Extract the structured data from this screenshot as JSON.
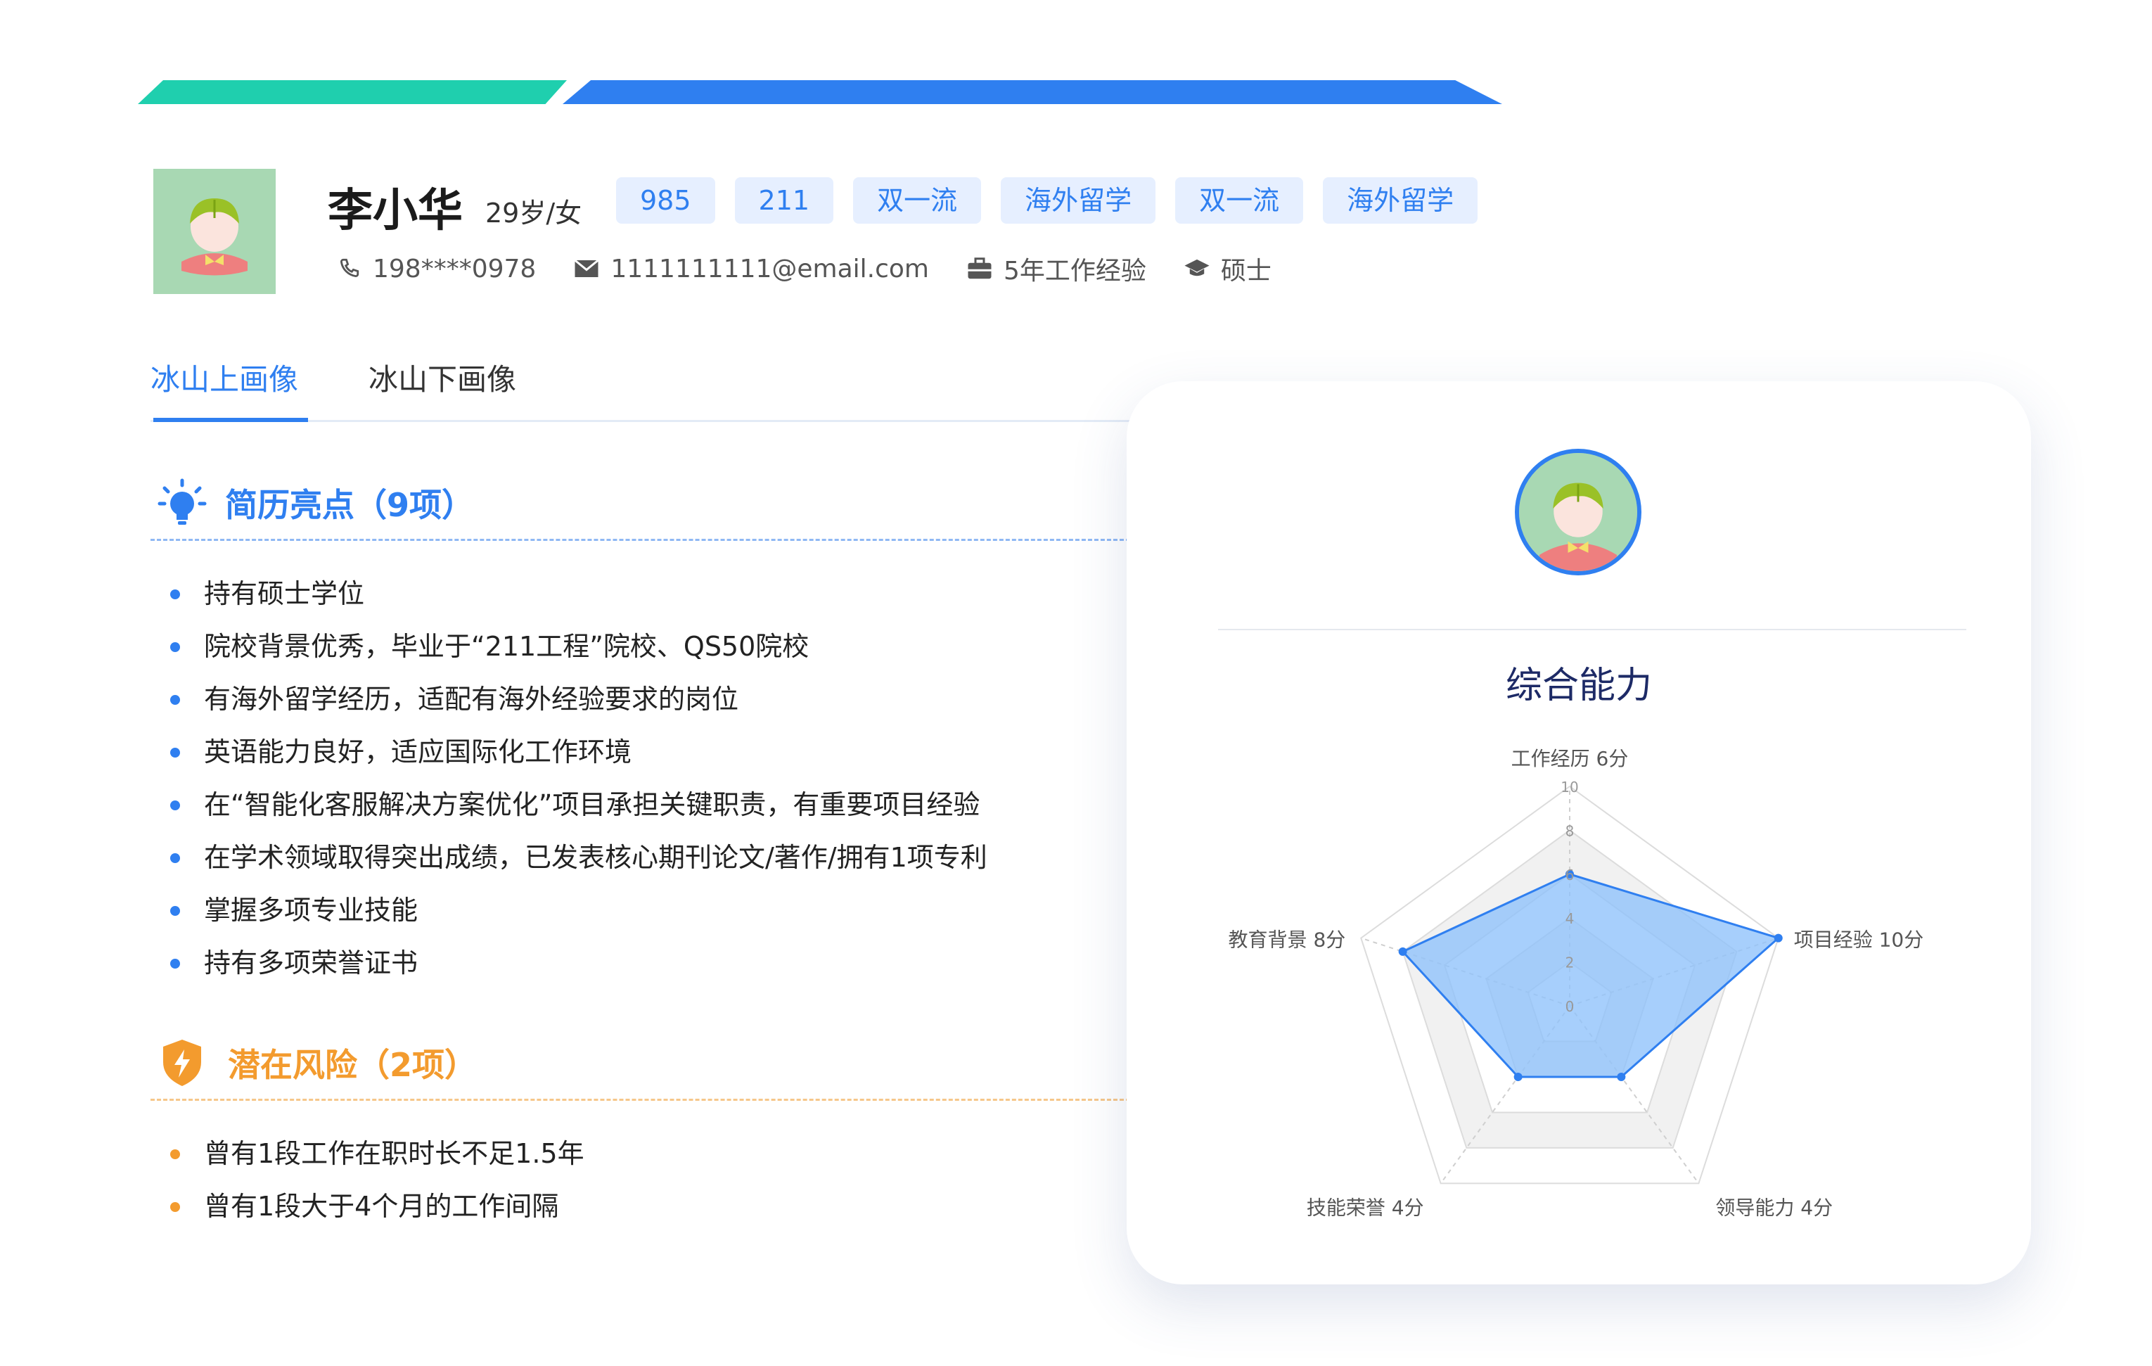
{
  "profile": {
    "name": "李小华",
    "age_gender": "29岁/女",
    "tags": [
      "985",
      "211",
      "双一流",
      "海外留学",
      "双一流",
      "海外留学"
    ],
    "phone": "198****0978",
    "email": "1111111111@email.com",
    "experience": "5年工作经验",
    "degree": "硕士"
  },
  "tabs": {
    "active": "冰山上画像",
    "inactive": "冰山下画像"
  },
  "highlights": {
    "title": "简历亮点（9项）",
    "items": [
      "持有硕士学位",
      "院校背景优秀，毕业于“211工程”院校、QS50院校",
      "有海外留学经历，适配有海外经验要求的岗位",
      "英语能力良好，适应国际化工作环境",
      "在“智能化客服解决方案优化”项目承担关键职责，有重要项目经验",
      "在学术领域取得突出成绩，已发表核心期刊论文/著作/拥有1项专利",
      "掌握多项专业技能",
      "持有多项荣誉证书"
    ]
  },
  "risks": {
    "title": "潜在风险（2项）",
    "items": [
      "曾有1段工作在职时长不足1.5年",
      "曾有1段大于4个月的工作间隔"
    ]
  },
  "card": {
    "title": "综合能力"
  },
  "chart_data": {
    "type": "radar",
    "axes": [
      "工作经历",
      "项目经验",
      "领导能力",
      "技能荣誉",
      "教育背景"
    ],
    "axis_labels": [
      "工作经历 6分",
      "项目经验 10分",
      "领导能力 4分",
      "技能荣誉 4分",
      "教育背景 8分"
    ],
    "values": [
      6,
      10,
      4,
      4,
      8
    ],
    "range": [
      0,
      10
    ],
    "ticks": [
      "0",
      "2",
      "4",
      "6",
      "8",
      "10"
    ]
  },
  "colors": {
    "accent": "#2f7ff0",
    "warning": "#f39b2e",
    "teal": "#1fcfae",
    "radar_fill": "#8ec2fb"
  }
}
